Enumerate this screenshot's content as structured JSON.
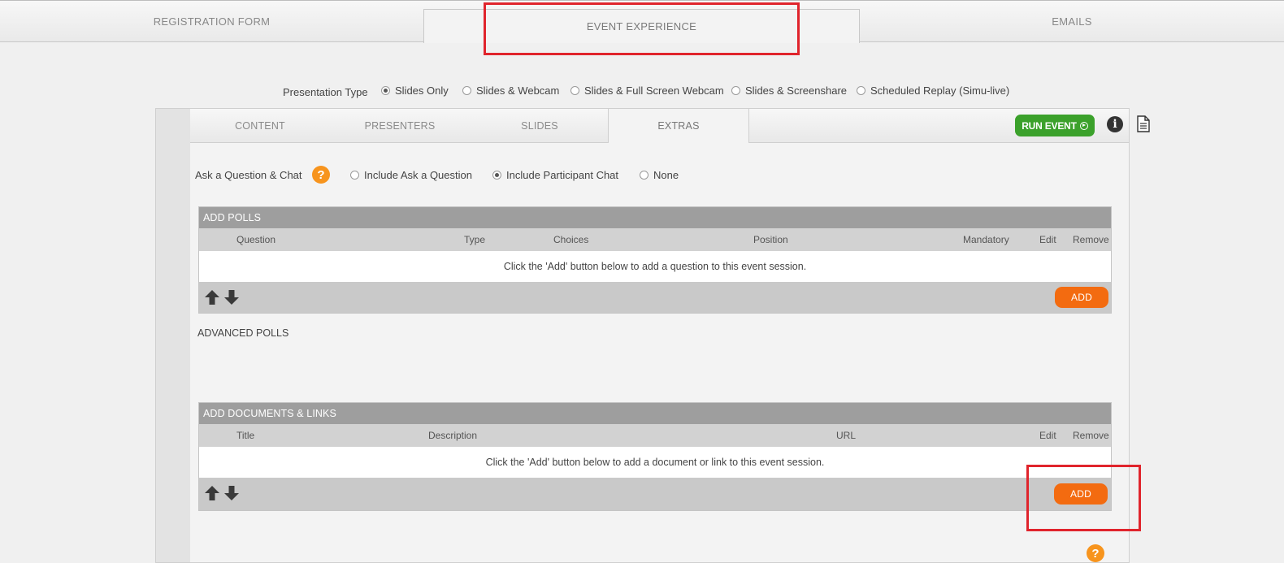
{
  "top_tabs": [
    {
      "label": "REGISTRATION FORM"
    },
    {
      "label": "EVENT EXPERIENCE"
    },
    {
      "label": "EMAILS"
    }
  ],
  "presentation_type": {
    "label": "Presentation Type",
    "options": [
      {
        "label": "Slides Only",
        "selected": true
      },
      {
        "label": "Slides & Webcam",
        "selected": false
      },
      {
        "label": "Slides & Full Screen Webcam",
        "selected": false
      },
      {
        "label": "Slides & Screenshare",
        "selected": false
      },
      {
        "label": "Scheduled Replay (Simu-live)",
        "selected": false
      }
    ]
  },
  "sub_tabs": [
    {
      "label": "CONTENT"
    },
    {
      "label": "PRESENTERS"
    },
    {
      "label": "SLIDES"
    },
    {
      "label": "EXTRAS"
    }
  ],
  "toolbar": {
    "run_event_label": "RUN EVENT",
    "info_icon": "info-icon",
    "document_icon": "document-icon"
  },
  "qa": {
    "label": "Ask a Question & Chat",
    "help_glyph": "?",
    "options": [
      {
        "label": "Include Ask a Question",
        "selected": false
      },
      {
        "label": "Include Participant Chat",
        "selected": true
      },
      {
        "label": "None",
        "selected": false
      }
    ]
  },
  "polls": {
    "title": "ADD POLLS",
    "columns": [
      "Question",
      "Type",
      "Choices",
      "Position",
      "Mandatory",
      "Edit",
      "Remove"
    ],
    "empty_message": "Click the 'Add' button below to add a question to this event session.",
    "add_label": "ADD"
  },
  "advanced_polls": {
    "label": "ADVANCED POLLS"
  },
  "documents": {
    "title": "ADD DOCUMENTS & LINKS",
    "columns": [
      "Title",
      "Description",
      "URL",
      "Edit",
      "Remove"
    ],
    "empty_message": "Click the 'Add' button below to add a document or link to this event session.",
    "add_label": "ADD"
  },
  "colors": {
    "accent_orange": "#f36b10",
    "run_green": "#3ba12b",
    "help_orange": "#f7941d",
    "highlight_red": "#e0242c"
  }
}
